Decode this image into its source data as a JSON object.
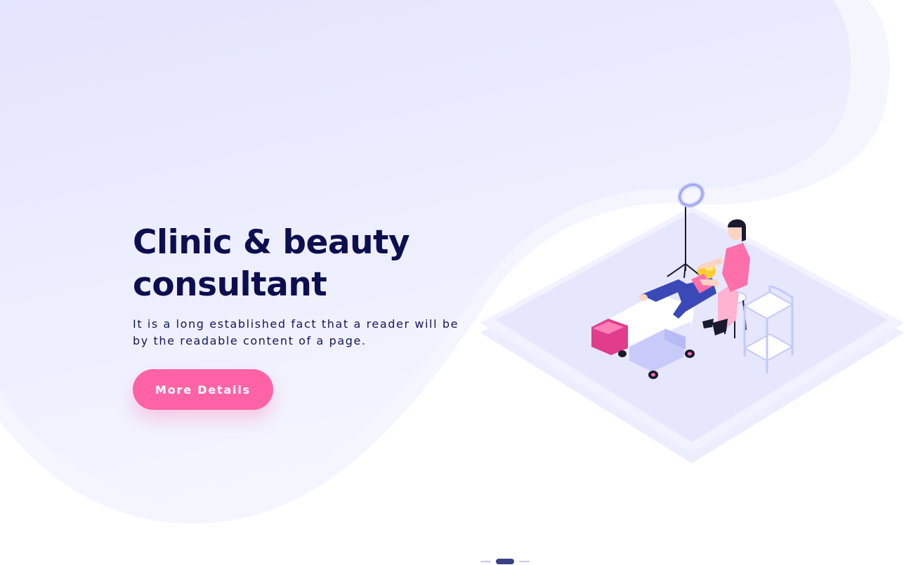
{
  "hero": {
    "title_line1": "Clinic & beauty",
    "title_line2": "consultant",
    "description": "It is a long established fact that a reader will be by the readable content of a page.",
    "cta_label": "More Details"
  },
  "illustration": {
    "icon": "beauty-treatment-illustration",
    "description_hidden": ""
  },
  "slider": {
    "slide_count": 3,
    "active_index": 1
  },
  "colors": {
    "title": "#0d0e4f",
    "text": "#14155a",
    "accent": "#ff63a6",
    "background_blob": "#e6e7ff",
    "pager_active": "#3c3f86"
  }
}
